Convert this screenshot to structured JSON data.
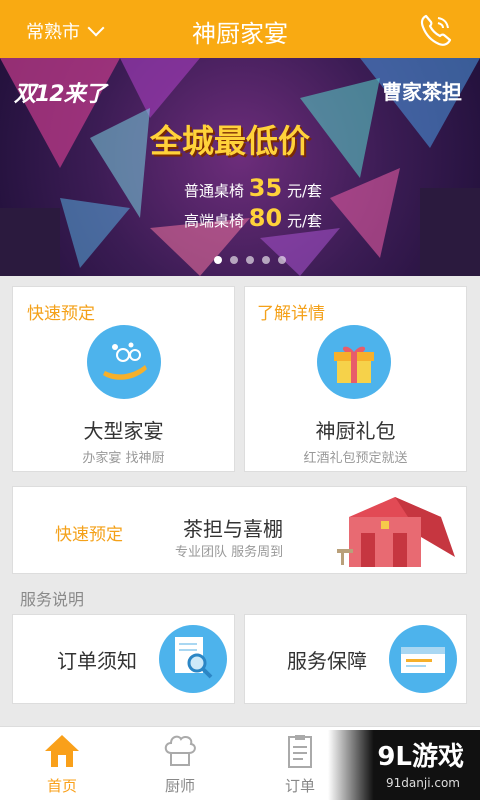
{
  "header": {
    "city": "常熟市",
    "title": "神厨家宴"
  },
  "banner": {
    "logo_left": "双12来了",
    "logo_right": "曹家茶担",
    "headline": "全城最低价",
    "line1_prefix": "普通桌椅",
    "line1_price": "35",
    "line1_suffix": "元/套",
    "line2_prefix": "高端桌椅",
    "line2_price": "80",
    "line2_suffix": "元/套"
  },
  "cards": {
    "card1": {
      "tag": "快速预定",
      "title": "大型家宴",
      "sub": "办家宴 找神厨"
    },
    "card2": {
      "tag": "了解详情",
      "title": "神厨礼包",
      "sub": "红酒礼包预定就送"
    },
    "card3": {
      "tag": "快速预定",
      "title": "茶担与喜棚",
      "sub": "专业团队 服务周到"
    }
  },
  "service": {
    "label": "服务说明",
    "item1": "订单须知",
    "item2": "服务保障"
  },
  "nav": {
    "items": [
      {
        "label": "首页"
      },
      {
        "label": "厨师"
      },
      {
        "label": "订单"
      },
      {
        "label": ""
      }
    ]
  },
  "watermark": {
    "main": "9L游戏",
    "sub": "91danji.com"
  },
  "colors": {
    "accent": "#f9aa12",
    "icon_blue": "#4db3ec"
  }
}
